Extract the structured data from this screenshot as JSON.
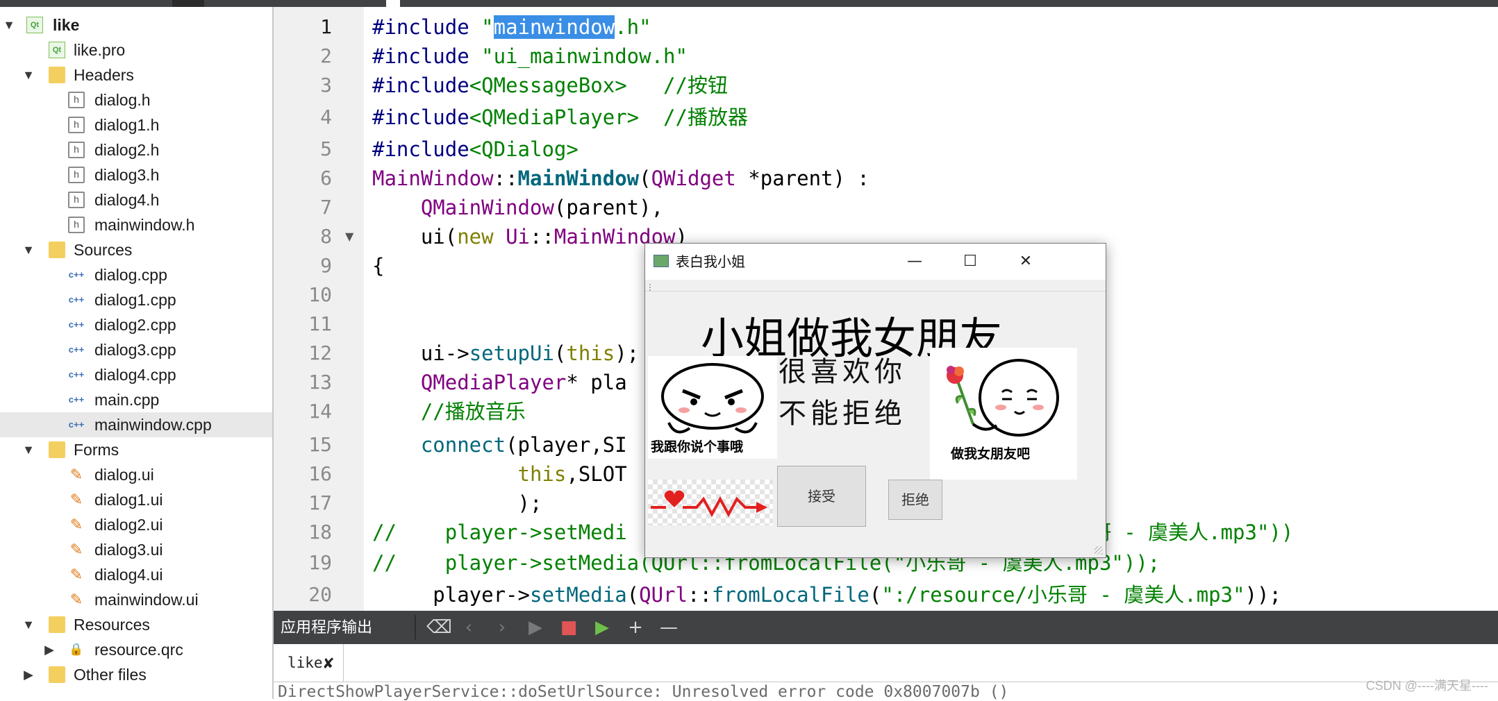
{
  "project": {
    "root": "like",
    "pro_file": "like.pro",
    "groups": {
      "headers": {
        "label": "Headers",
        "items": [
          "dialog.h",
          "dialog1.h",
          "dialog2.h",
          "dialog3.h",
          "dialog4.h",
          "mainwindow.h"
        ]
      },
      "sources": {
        "label": "Sources",
        "items": [
          "dialog.cpp",
          "dialog1.cpp",
          "dialog2.cpp",
          "dialog3.cpp",
          "dialog4.cpp",
          "main.cpp",
          "mainwindow.cpp"
        ]
      },
      "forms": {
        "label": "Forms",
        "items": [
          "dialog.ui",
          "dialog1.ui",
          "dialog2.ui",
          "dialog3.ui",
          "dialog4.ui",
          "mainwindow.ui"
        ]
      },
      "resources": {
        "label": "Resources",
        "items": [
          "resource.qrc"
        ]
      },
      "other": {
        "label": "Other files"
      }
    },
    "selected": "mainwindow.cpp"
  },
  "editor": {
    "line_numbers": [
      "1",
      "2",
      "3",
      "4",
      "5",
      "6",
      "7",
      "8",
      "9",
      "10",
      "11",
      "12",
      "13",
      "14",
      "15",
      "16",
      "17",
      "18",
      "19",
      "20"
    ],
    "current_line": "1",
    "lines": [
      [
        {
          "t": "#include ",
          "c": "pp"
        },
        {
          "t": "\"",
          "c": "str"
        },
        {
          "t": "mainwindow",
          "c": "hl"
        },
        {
          "t": ".h\"",
          "c": "str"
        }
      ],
      [
        {
          "t": "#include ",
          "c": "pp"
        },
        {
          "t": "\"ui_mainwindow.h\"",
          "c": "str"
        }
      ],
      [
        {
          "t": "#include",
          "c": "pp"
        },
        {
          "t": "<QMessageBox>",
          "c": "str"
        },
        {
          "t": "   //按钮",
          "c": "cm"
        }
      ],
      [
        {
          "t": "#include",
          "c": "pp"
        },
        {
          "t": "<QMediaPlayer>",
          "c": "str"
        },
        {
          "t": "  //播放器",
          "c": "cm"
        }
      ],
      [
        {
          "t": "#include",
          "c": "pp"
        },
        {
          "t": "<QDialog>",
          "c": "str"
        }
      ],
      [
        {
          "t": "MainWindow",
          "c": "ty"
        },
        {
          "t": "::",
          "c": ""
        },
        {
          "t": "MainWindow",
          "c": "fnb"
        },
        {
          "t": "(",
          "c": ""
        },
        {
          "t": "QWidget",
          "c": "ty"
        },
        {
          "t": " *parent) :",
          "c": ""
        }
      ],
      [
        {
          "t": "    ",
          "c": ""
        },
        {
          "t": "QMainWindow",
          "c": "ty"
        },
        {
          "t": "(parent),",
          "c": ""
        }
      ],
      [
        {
          "t": "    ui(",
          "c": ""
        },
        {
          "t": "new",
          "c": "kw"
        },
        {
          "t": " ",
          "c": ""
        },
        {
          "t": "Ui",
          "c": "ty"
        },
        {
          "t": "::",
          "c": ""
        },
        {
          "t": "MainWindow",
          "c": "ty"
        },
        {
          "t": ")",
          "c": ""
        }
      ],
      [
        {
          "t": "{",
          "c": ""
        }
      ],
      [],
      [],
      [
        {
          "t": "    ui->",
          "c": ""
        },
        {
          "t": "setupUi",
          "c": "fn"
        },
        {
          "t": "(",
          "c": ""
        },
        {
          "t": "this",
          "c": "kw"
        },
        {
          "t": ");",
          "c": ""
        }
      ],
      [
        {
          "t": "    ",
          "c": ""
        },
        {
          "t": "QMediaPlayer",
          "c": "ty"
        },
        {
          "t": "* pla",
          "c": ""
        }
      ],
      [
        {
          "t": "    //播放音乐",
          "c": "cm"
        }
      ],
      [
        {
          "t": "    ",
          "c": ""
        },
        {
          "t": "connect",
          "c": "fn"
        },
        {
          "t": "(player,SI",
          "c": ""
        }
      ],
      [
        {
          "t": "            ",
          "c": ""
        },
        {
          "t": "this",
          "c": "kw"
        },
        {
          "t": ",SLOT",
          "c": ""
        }
      ],
      [
        {
          "t": "            );",
          "c": ""
        }
      ],
      [
        {
          "t": "//    player->setMedi",
          "c": "cm"
        },
        {
          "t": "                         ",
          "c": ""
        },
        {
          "t": "ents/like/小乐哥 - 虞美人.mp3\"))",
          "c": "cm"
        }
      ],
      [
        {
          "t": "//    player->setMedia(QUrl::fromLocalFile(\"小乐哥 - 虞美人.mp3\"));",
          "c": "cm"
        }
      ],
      [
        {
          "t": "     player->",
          "c": ""
        },
        {
          "t": "setMedia",
          "c": "fn"
        },
        {
          "t": "(",
          "c": ""
        },
        {
          "t": "QUrl",
          "c": "ty"
        },
        {
          "t": "::",
          "c": ""
        },
        {
          "t": "fromLocalFile",
          "c": "fn"
        },
        {
          "t": "(",
          "c": ""
        },
        {
          "t": "\":/resource/小乐哥 - 虞美人.mp3\"",
          "c": "str"
        },
        {
          "t": "));",
          "c": ""
        }
      ]
    ]
  },
  "output": {
    "title": "应用程序输出",
    "tab_label": "like",
    "tab_close": "✘",
    "text": "DirectShowPlayerService::doSetUrlSource: Unresolved error code 0x8007007b ()",
    "buttons": [
      "broom-icon",
      "prev-icon",
      "next-icon",
      "run-icon",
      "stop-icon",
      "debug-run-icon",
      "plus-icon",
      "minus-icon"
    ]
  },
  "dialog": {
    "title": "表白我小姐",
    "heading": "小姐做我女朋友",
    "text_line1": "很喜欢你",
    "text_line2": "不能拒绝",
    "left_sticker_caption": "我跟你说个事哦",
    "right_sticker_caption": "做我女朋友吧",
    "accept_label": "接受",
    "reject_label": "拒绝",
    "minimize_glyph": "—",
    "maximize_glyph": "☐",
    "close_glyph": "✕"
  },
  "watermark": "CSDN @----满天星----",
  "colors": {
    "keyword": "#808000",
    "preprocessor": "#000080",
    "string": "#008000",
    "type": "#800080",
    "function": "#00677c",
    "selection": "#3a8ee6",
    "output_bar": "#404244"
  }
}
